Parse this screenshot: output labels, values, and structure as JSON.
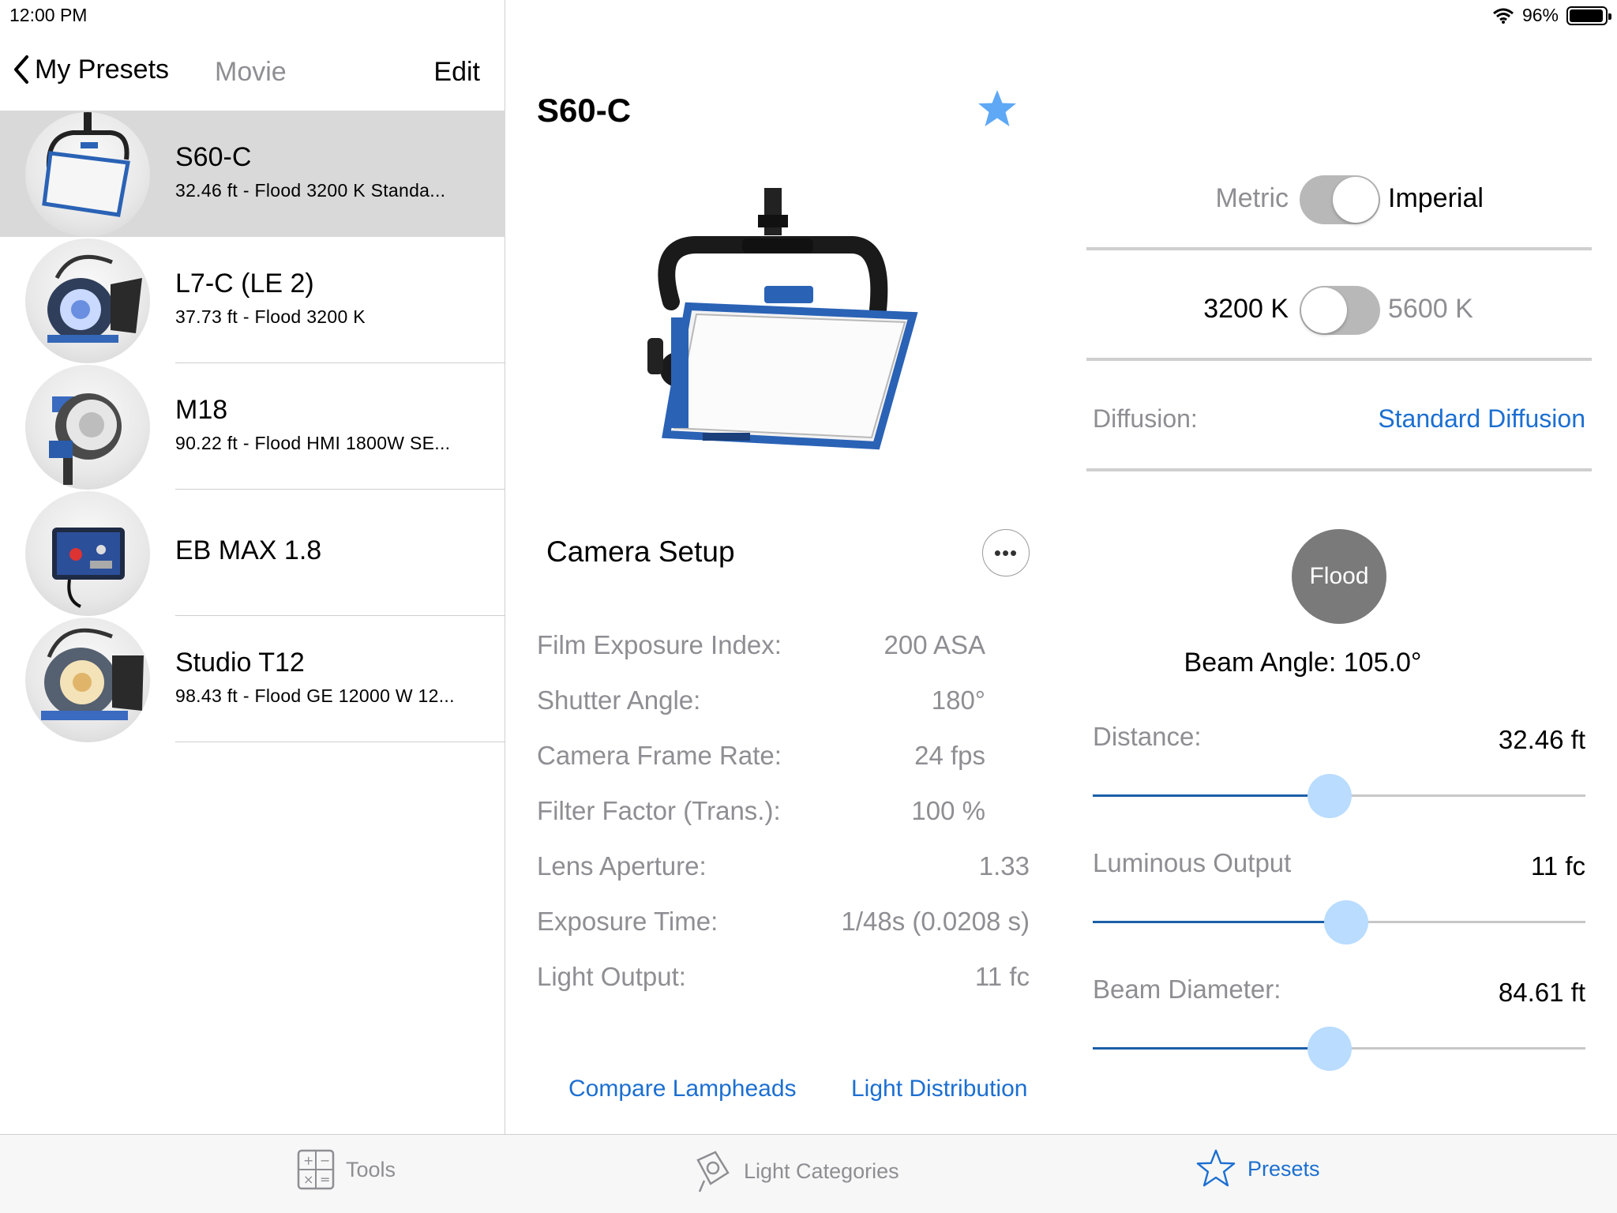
{
  "status": {
    "time": "12:00 PM",
    "battery": "96%",
    "battery_level": 0.96
  },
  "nav": {
    "back_label": "My Presets",
    "title": "Movie",
    "edit_label": "Edit"
  },
  "presets": [
    {
      "name": "S60-C",
      "subtitle": "32.46 ft -  Flood 3200 K Standa...",
      "selected": true
    },
    {
      "name": "L7-C (LE 2)",
      "subtitle": "37.73 ft -  Flood 3200 K",
      "selected": false
    },
    {
      "name": "M18",
      "subtitle": "90.22 ft -  Flood HMI 1800W SE...",
      "selected": false
    },
    {
      "name": "EB MAX 1.8",
      "subtitle": "",
      "selected": false
    },
    {
      "name": "Studio T12",
      "subtitle": "98.43 ft -  Flood GE 12000 W 12...",
      "selected": false
    }
  ],
  "detail": {
    "title": "S60-C",
    "camera_setup_title": "Camera Setup",
    "more_label": "•••",
    "params": [
      {
        "label": "Film Exposure Index:",
        "value": "200 ASA"
      },
      {
        "label": "Shutter Angle:",
        "value": "180°"
      },
      {
        "label": "Camera Frame Rate:",
        "value": "24 fps"
      },
      {
        "label": "Filter Factor (Trans.):",
        "value": "100 %"
      },
      {
        "label": "Lens Aperture:",
        "value": "1.33"
      },
      {
        "label": "Exposure Time:",
        "value": "1/48s (0.0208 s)"
      },
      {
        "label": "Light Output:",
        "value": "11 fc"
      }
    ],
    "compare_link": "Compare Lampheads",
    "distribution_link": "Light Distribution"
  },
  "settings": {
    "unit_left": "Metric",
    "unit_right": "Imperial",
    "unit_selected": "Imperial",
    "temp_left": "3200 K",
    "temp_right": "5600 K",
    "temp_selected": "3200 K",
    "diffusion_label": "Diffusion:",
    "diffusion_value": "Standard Diffusion",
    "beam_mode": "Flood",
    "beam_angle": "Beam Angle: 105.0°",
    "sliders": [
      {
        "label": "Distance:",
        "value": "32.46  ft",
        "position": 0.48
      },
      {
        "label": "Luminous Output",
        "value": "11  fc",
        "position": 0.515
      },
      {
        "label": "Beam Diameter:",
        "value": "84.61  ft",
        "position": 0.48
      }
    ]
  },
  "tabs": [
    {
      "label": "Tools",
      "icon": "calculator-icon",
      "active": false
    },
    {
      "label": "Light Categories",
      "icon": "lamp-category-icon",
      "active": false
    },
    {
      "label": "Presets",
      "icon": "star-outline-icon",
      "active": true
    }
  ],
  "colors": {
    "accent": "#1c6fd1",
    "selected_row": "#d9d9d9",
    "slider_fill": "#1b5fa8",
    "slider_thumb": "#b9dcff",
    "star": "#5ea8f5"
  }
}
